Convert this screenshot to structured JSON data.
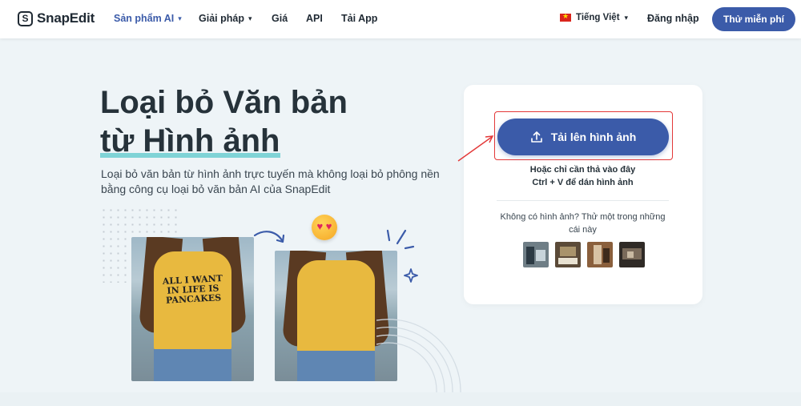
{
  "nav": {
    "logo_text": "SnapEdit",
    "logo_mark": "S",
    "items": [
      {
        "label": "Sản phẩm AI",
        "has_dropdown": true,
        "active": true
      },
      {
        "label": "Giải pháp",
        "has_dropdown": true,
        "active": false
      },
      {
        "label": "Giá",
        "has_dropdown": false,
        "active": false
      },
      {
        "label": "API",
        "has_dropdown": false,
        "active": false
      },
      {
        "label": "Tải App",
        "has_dropdown": false,
        "active": false
      }
    ],
    "language": "Tiếng Việt",
    "login": "Đăng nhập",
    "cta": "Thử miễn phí"
  },
  "hero": {
    "title_line1": "Loại bỏ Văn bản",
    "title_line2": "từ Hình ảnh",
    "description": "Loại bỏ văn bản từ hình ảnh trực tuyến mà không loại bỏ phông nền bằng công cụ loại bỏ văn bản AI của SnapEdit",
    "shirt_text": "ALL I WANT IN LIFE IS PANCAKES"
  },
  "upload": {
    "button_label": "Tải lên hình ảnh",
    "drop_hint_line1": "Hoặc chỉ cần thả vào đây",
    "drop_hint_line2": "Ctrl + V để dán hình ảnh",
    "sample_hint": "Không có hình ảnh? Thử một trong những cái này"
  },
  "colors": {
    "accent": "#3b5ba9",
    "highlight": "#7fd3d6",
    "annotation_red": "#e33838",
    "shirt": "#e8b93f"
  }
}
